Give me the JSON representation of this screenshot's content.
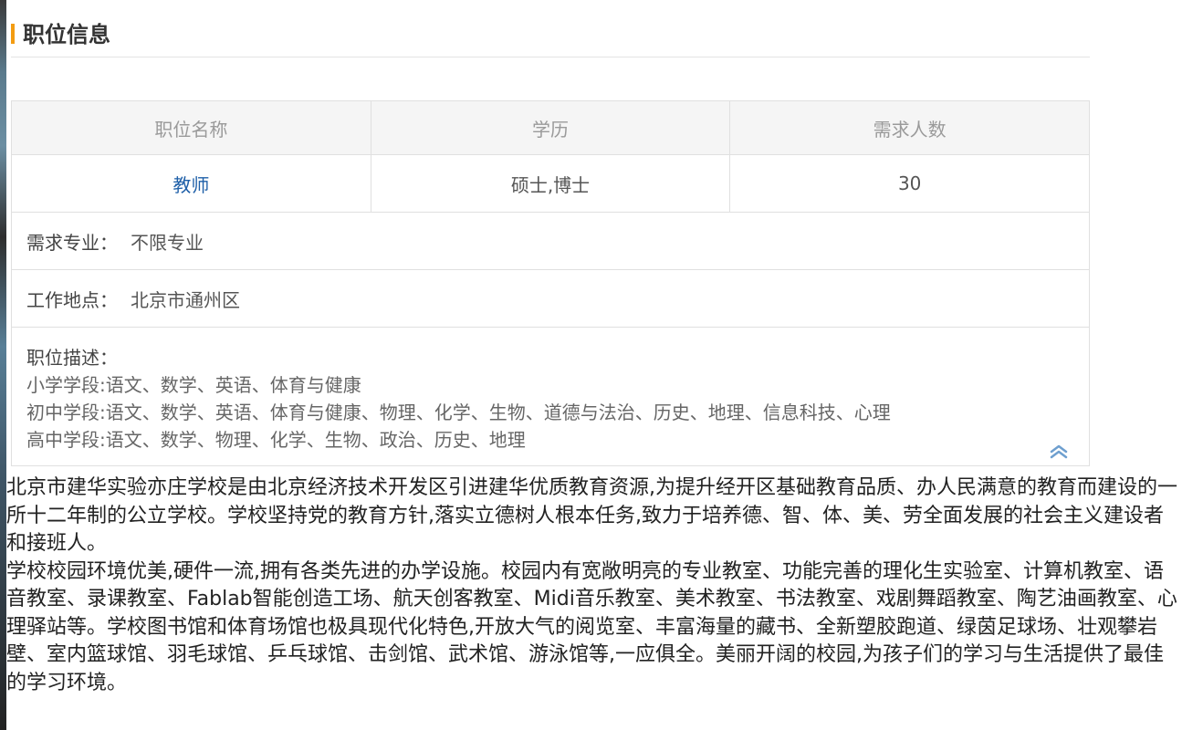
{
  "section": {
    "title": "职位信息"
  },
  "table": {
    "headers": [
      "职位名称",
      "学历",
      "需求人数"
    ],
    "row": {
      "position": "教师",
      "education": "硕士,博士",
      "count": "30"
    },
    "major": {
      "label": "需求专业：",
      "value": "不限专业"
    },
    "location": {
      "label": "工作地点：",
      "value": "北京市通州区"
    },
    "description": {
      "label": "职位描述：",
      "lines": [
        "小学学段:语文、数学、英语、体育与健康",
        "初中学段:语文、数学、英语、体育与健康、物理、化学、生物、道德与法治、历史、地理、信息科技、心理",
        "高中学段:语文、数学、物理、化学、生物、政治、历史、地理"
      ],
      "collapse_icon": "double-chevron-up-icon"
    }
  },
  "intro": {
    "paragraphs": [
      "北京市建华实验亦庄学校是由北京经济技术开发区引进建华优质教育资源,为提升经开区基础教育品质、办人民满意的教育而建设的一所十二年制的公立学校。学校坚持党的教育方针,落实立德树人根本任务,致力于培养德、智、体、美、劳全面发展的社会主义建设者和接班人。",
      "学校校园环境优美,硬件一流,拥有各类先进的办学设施。校园内有宽敞明亮的专业教室、功能完善的理化生实验室、计算机教室、语音教室、录课教室、Fablab智能创造工场、航天创客教室、Midi音乐教室、美术教室、书法教室、戏剧舞蹈教室、陶艺油画教室、心理驿站等。学校图书馆和体育场馆也极具现代化特色,开放大气的阅览室、丰富海量的藏书、全新塑胶跑道、绿茵足球场、壮观攀岩壁、室内篮球馆、羽毛球馆、乒乓球馆、击剑馆、武术馆、游泳馆等,一应俱全。美丽开阔的校园,为孩子们的学习与生活提供了最佳的学习环境。"
    ]
  },
  "colors": {
    "accent_bar": "#f39c12",
    "link": "#1e5fa8",
    "header_bg": "#f5f5f5",
    "border": "#e0e0e0"
  }
}
